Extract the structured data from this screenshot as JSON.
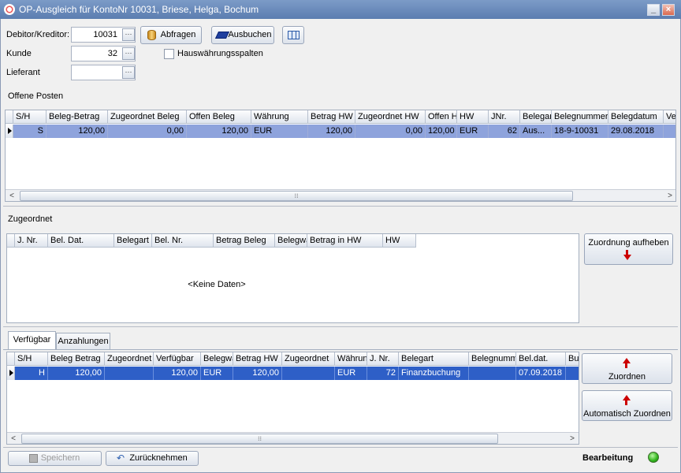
{
  "window": {
    "title": "OP-Ausgleich für KontoNr 10031, Briese, Helga, Bochum",
    "minimize_glyph": "_",
    "close_glyph": "×"
  },
  "form": {
    "debitor_label": "Debitor/Kreditor:",
    "debitor_value": "10031",
    "kunde_label": "Kunde",
    "kunde_value": "32",
    "lieferant_label": "Lieferant",
    "lieferant_value": "",
    "ellipsis": "···",
    "abfragen_label": "Abfragen",
    "ausbuchen_label": "Ausbuchen",
    "hauswaehrung_label": "Hauswährungsspalten",
    "hauswaehrung_checked": false
  },
  "offene_posten": {
    "title": "Offene Posten",
    "columns": [
      "S/H",
      "Beleg-Betrag",
      "Zugeordnet Beleg",
      "Offen Beleg",
      "Währung",
      "Betrag HW",
      "Zugeordnet HW",
      "Offen H",
      "HW",
      "JNr.",
      "Belegar",
      "Belegnummer",
      "Belegdatum",
      "Ver"
    ],
    "rows": [
      [
        "S",
        "120,00",
        "0,00",
        "120,00",
        "EUR",
        "120,00",
        "0,00",
        "120,00",
        "EUR",
        "62",
        "Aus...",
        "18-9-10031",
        "29.08.2018",
        ""
      ]
    ]
  },
  "zugeordnet": {
    "title": "Zugeordnet",
    "columns": [
      "J. Nr.",
      "Bel. Dat.",
      "Belegart",
      "Bel. Nr.",
      "Betrag Beleg",
      "Belegwä",
      "Betrag in HW",
      "HW"
    ],
    "empty_text": "<Keine Daten>",
    "aufheben_label": "Zuordnung aufheben"
  },
  "tabs": [
    {
      "label": "Verfügbar",
      "active": true
    },
    {
      "label": "Anzahlungen",
      "active": false
    }
  ],
  "verfuegbar": {
    "columns": [
      "S/H",
      "Beleg Betrag",
      "Zugeordnet",
      "Verfügbar",
      "Belegwä",
      "Betrag HW",
      "Zugeordnet",
      "Währun",
      "J. Nr.",
      "Belegart",
      "Belegnumme",
      "Bel.dat.",
      "Buch"
    ],
    "rows": [
      [
        "H",
        "120,00",
        "",
        "120,00",
        "EUR",
        "120,00",
        "",
        "EUR",
        "72",
        "Finanzbuchung",
        "",
        "07.09.2018",
        ""
      ]
    ],
    "zuordnen_label": "Zuordnen",
    "auto_zuordnen_label": "Automatisch Zuordnen"
  },
  "footer": {
    "speichern_label": "Speichern",
    "zuruecknehmen_label": "Zurücknehmen",
    "status_text": "Bearbeitung",
    "status_color": "#2fb31b"
  },
  "scroll_glyphs": {
    "left": "<",
    "right": ">",
    "grip": "⁝⁝"
  }
}
